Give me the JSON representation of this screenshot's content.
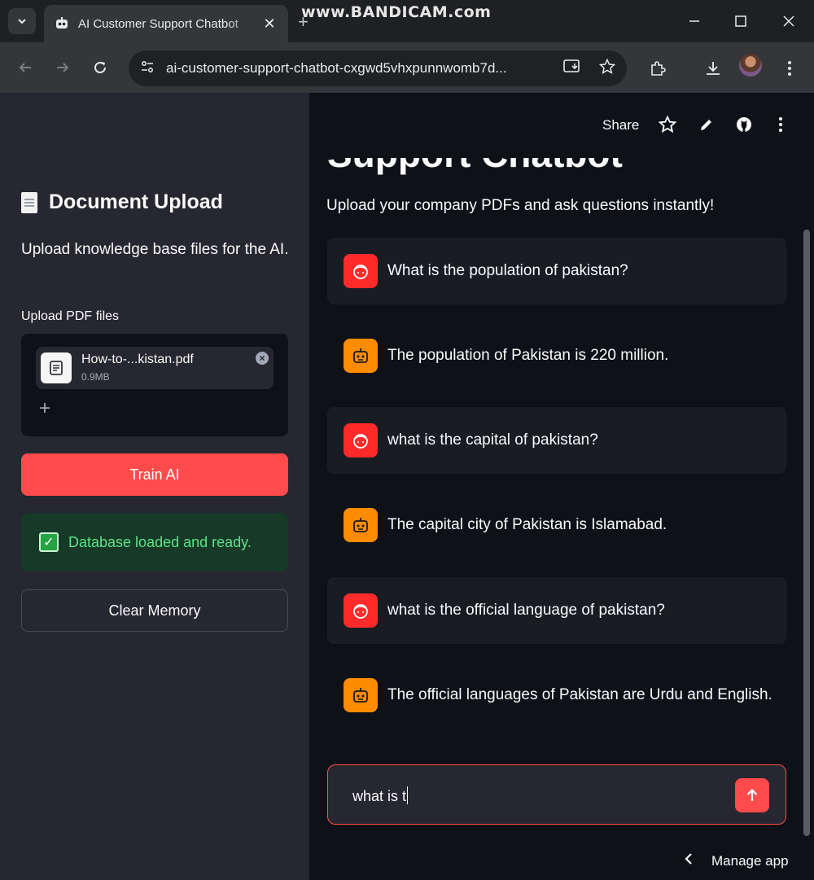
{
  "browser": {
    "tab_title": "AI Customer Support Chatbot",
    "url": "ai-customer-support-chatbot-cxgwd5vhxpunnwomb7d...",
    "watermark": "www.BANDICAM.com",
    "icons": [
      "tab-search-icon",
      "robot-favicon-icon",
      "close-icon",
      "new-tab-icon",
      "minimize-icon",
      "maximize-icon",
      "close-window-icon",
      "back-icon",
      "forward-icon",
      "reload-icon",
      "site-info-icon",
      "install-app-icon",
      "star-icon",
      "extensions-icon",
      "download-icon",
      "kebab-menu-icon"
    ]
  },
  "sidebar": {
    "header": "Document Upload",
    "description": "Upload knowledge base files for the AI.",
    "upload_label": "Upload PDF files",
    "file": {
      "name": "How-to-...kistan.pdf",
      "size": "0.9MB"
    },
    "train_button": "Train AI",
    "status": "Database loaded and ready.",
    "clear_button": "Clear Memory"
  },
  "main": {
    "share_label": "Share",
    "title": "Support Chatbot",
    "subtitle": "Upload your company PDFs and ask questions instantly!",
    "messages": [
      {
        "role": "user",
        "text": "What is the population of pakistan?"
      },
      {
        "role": "assistant",
        "text": "The population of Pakistan is 220 million."
      },
      {
        "role": "user",
        "text": "what is the capital of pakistan?"
      },
      {
        "role": "assistant",
        "text": "The capital city of Pakistan is Islamabad."
      },
      {
        "role": "user",
        "text": "what is the official language of pakistan?"
      },
      {
        "role": "assistant",
        "text": "The official languages of Pakistan are Urdu and English."
      }
    ],
    "input_value": "what is t",
    "manage_app": "Manage app"
  },
  "colors": {
    "accent": "#ff4b4b",
    "user_avatar": "#ff2b2b",
    "bot_avatar": "#ff8c00",
    "success_text": "#5ce488",
    "sidebar_bg": "#262730",
    "main_bg": "#0e1117"
  }
}
